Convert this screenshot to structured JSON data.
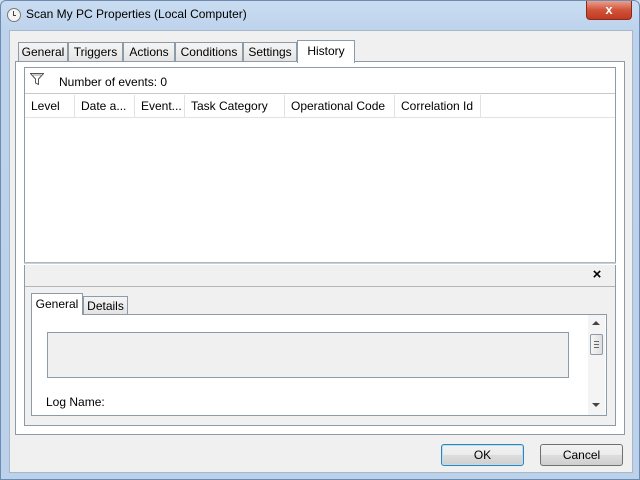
{
  "window": {
    "title": "Scan My PC Properties (Local Computer)",
    "close_glyph": "x",
    "icon": "clock-icon"
  },
  "tabs": [
    {
      "label": "General",
      "active": false
    },
    {
      "label": "Triggers",
      "active": false
    },
    {
      "label": "Actions",
      "active": false
    },
    {
      "label": "Conditions",
      "active": false
    },
    {
      "label": "Settings",
      "active": false
    },
    {
      "label": "History",
      "active": true
    }
  ],
  "history": {
    "filter_icon": "filter-icon",
    "event_count": "Number of events: 0",
    "columns": [
      "Level",
      "Date a...",
      "Event...",
      "Task Category",
      "Operational Code",
      "Correlation Id"
    ],
    "rows": []
  },
  "detail": {
    "close_glyph": "×",
    "tabs": [
      {
        "label": "General",
        "active": true
      },
      {
        "label": "Details",
        "active": false
      }
    ],
    "log_name_label": "Log Name:"
  },
  "buttons": {
    "ok": "OK",
    "cancel": "Cancel"
  },
  "colors": {
    "frame": "#bcd2ea",
    "client": "#f0f0f0",
    "default_button_border": "#3c7fb1",
    "close_button": "#c13a20"
  }
}
